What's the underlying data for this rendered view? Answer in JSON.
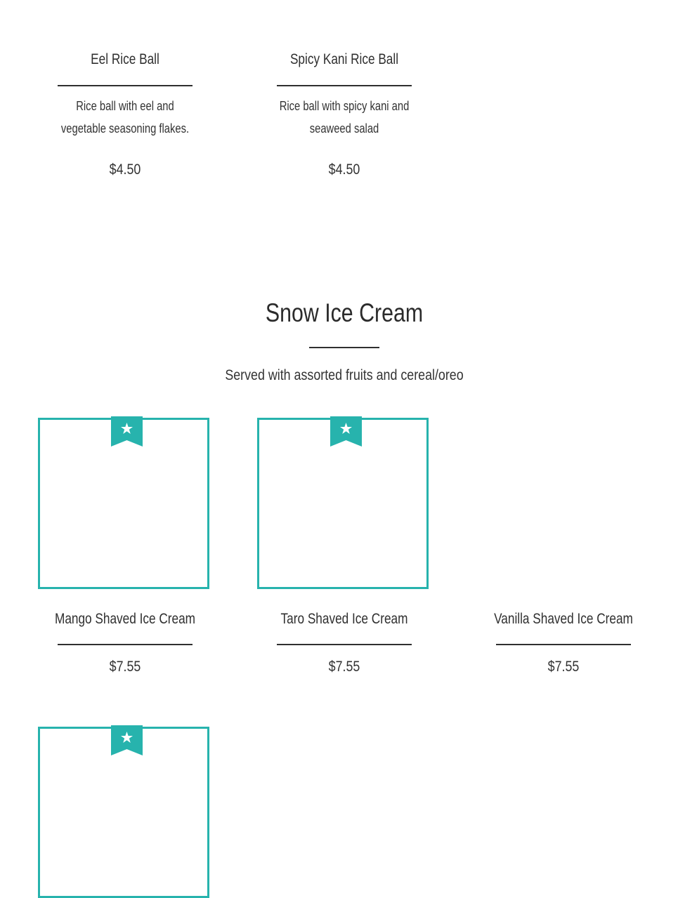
{
  "items_top": [
    {
      "name": "Eel Rice Ball",
      "description": "Rice ball with eel and vegetable seasoning flakes.",
      "price": "$4.50"
    },
    {
      "name": "Spicy Kani Rice Ball",
      "description": "Rice ball with spicy kani and seaweed salad",
      "price": "$4.50"
    }
  ],
  "section": {
    "title": "Snow Ice Cream",
    "subtitle": "Served with assorted fruits and cereal/oreo"
  },
  "items_ice": [
    {
      "name": "Mango Shaved Ice Cream",
      "price": "$7.55",
      "featured": true
    },
    {
      "name": "Taro Shaved Ice Cream",
      "price": "$7.55",
      "featured": true
    },
    {
      "name": "Vanilla Shaved Ice Cream",
      "price": "$7.55",
      "featured": false
    }
  ],
  "next_item": {
    "featured": true
  },
  "colors": {
    "accent": "#27b3ad",
    "text": "#2b2b2b",
    "background": "#ffffff"
  },
  "icons": {
    "featured_badge": "star-bookmark-icon"
  }
}
